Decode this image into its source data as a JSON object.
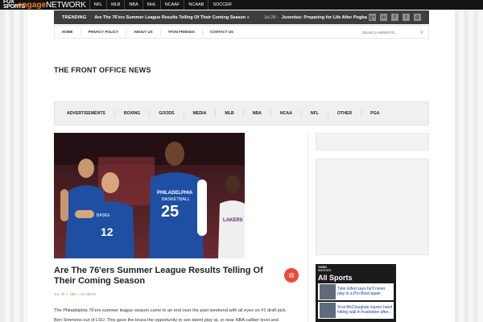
{
  "network_bar": {
    "logo_fox": "FOX SPORTS",
    "logo_engage": "engage",
    "logo_network": "NETWORK",
    "nets": [
      "NFL",
      "MLB",
      "NBA",
      "NHL",
      "NCAAF",
      "NCAAB",
      "SOCCER"
    ]
  },
  "trending": {
    "label": "TRENDING",
    "headline": "Are The 76'ers Summer League Results Telling Of Their Coming Season »",
    "date2": "Jul 28 -",
    "headline2": "Juventus: Preparing for Life After Pogba",
    "social_icons": [
      "google-plus-icon",
      "linkedin-icon",
      "facebook-icon",
      "twitter-icon",
      "instagram-icon"
    ],
    "social_glyphs": [
      "g+",
      "in",
      "f",
      "t",
      "◎"
    ]
  },
  "subnav": {
    "items": [
      "HOME",
      "PRIVACY POLICY",
      "ABOUT US",
      "TFON FRIENDS",
      "CONTACT US"
    ],
    "search_placeholder": "SEARCH WEBSITE..."
  },
  "site_title": "THE FRONT OFFICE NEWS",
  "categories": [
    "ADVERTISEMENTS",
    "BOXING",
    "GOODS",
    "MEDIA",
    "MLB",
    "NBA",
    "NCAA",
    "NFL",
    "OTHER",
    "PGA"
  ],
  "hero": {
    "jersey_text_1": "PHILADELPHIA",
    "jersey_text_2": "BASKETBALL",
    "jersey_number_1": "25",
    "jersey_number_2": "12",
    "jersey_text_3": "LAKERS",
    "jersey_text_4": "BASKE"
  },
  "article": {
    "title": "Are The 76'ers Summer League Results Telling Of Their Coming Season",
    "meta_date": "JUL 28",
    "meta_sep": "•",
    "meta_category": "NBA",
    "meta_views": "• 22 VIEWS",
    "excerpt_line1": "The Philadelphia 76'ers summer league season came to an end over the past weekend with all eyes on #1 draft pick",
    "excerpt_line2": "Ben Simmons out of LSU.  This gave the brass the opportunity to see talent play at, or near NBA caliber level and"
  },
  "sidebar_widget": {
    "brand_line1": "YARD",
    "brand_line2": "BARKER",
    "heading": "All Sports",
    "stories": [
      "Tyler Eifert says he'll never play in a Pro Bowl again",
      "Scot McCloughan injures hand hitting wall in frustration after..."
    ]
  },
  "colors": {
    "accent": "#f47a20",
    "dark_bar": "#3d3d3d",
    "pdf_red": "#e74c3c",
    "link_blue": "#1a3c8f",
    "jersey_blue": "#1e4fa3"
  }
}
